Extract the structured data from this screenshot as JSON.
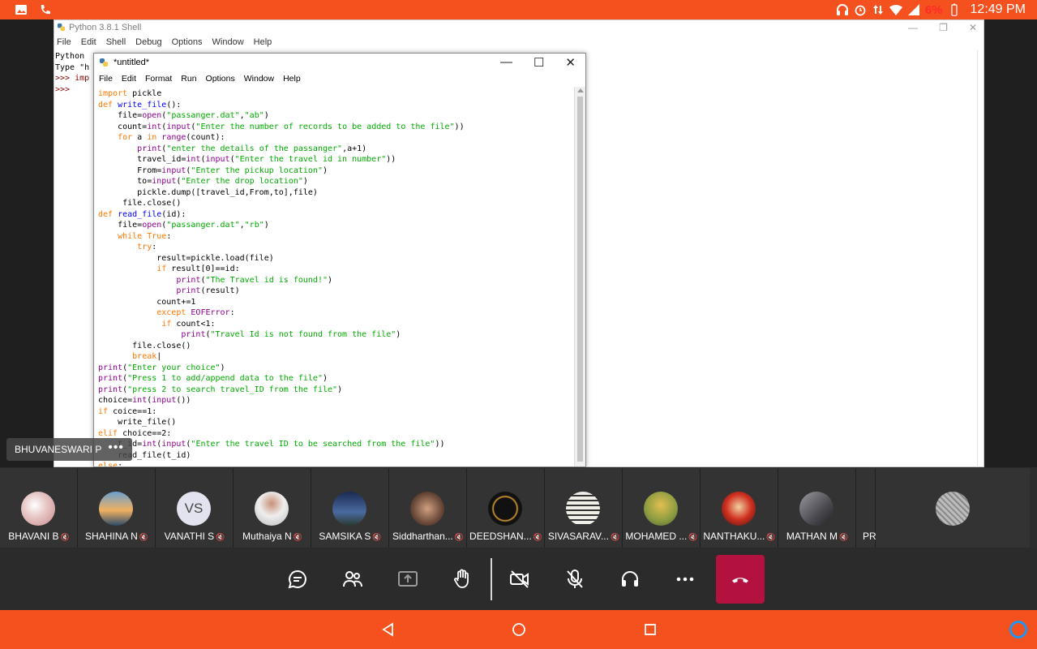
{
  "status_bar": {
    "battery_percent": "6%",
    "time": "12:49 PM",
    "icons": [
      "gallery-icon",
      "phone-icon",
      "headset-icon",
      "alarm-icon",
      "data-arrows-icon",
      "wifi-icon",
      "signal-icon",
      "battery-icon"
    ]
  },
  "shell": {
    "title": "Python 3.8.1 Shell",
    "menu": [
      "File",
      "Edit",
      "Shell",
      "Debug",
      "Options",
      "Window",
      "Help"
    ],
    "lines": [
      "Python",
      "Type \"h",
      ">>> imp",
      ">>>"
    ]
  },
  "editor": {
    "title": "*untitled*",
    "menu": [
      "File",
      "Edit",
      "Format",
      "Run",
      "Options",
      "Window",
      "Help"
    ]
  },
  "speaker": {
    "name": "BHUVANESWARI P",
    "more": "•••"
  },
  "participants": [
    {
      "name": "BHAVANI B",
      "avatar": "photo",
      "color": "#e8c8c8"
    },
    {
      "name": "SHAHINA N",
      "avatar": "photo",
      "color": "#4a7fb0"
    },
    {
      "name": "VANATHI S",
      "avatar": "VS",
      "color": "#e3e3f0"
    },
    {
      "name": "Muthaiya N",
      "avatar": "photo",
      "color": "#d8d0cc"
    },
    {
      "name": "SAMSIKA S",
      "avatar": "photo",
      "color": "#3a5a8a"
    },
    {
      "name": "Siddharthan...",
      "avatar": "photo",
      "color": "#6b4a3a"
    },
    {
      "name": "DEEDSHAN...",
      "avatar": "photo",
      "color": "#111111"
    },
    {
      "name": "SIVASARAV...",
      "avatar": "photo",
      "color": "#c8c8c0"
    },
    {
      "name": "MOHAMED ...",
      "avatar": "photo",
      "color": "#a8a050"
    },
    {
      "name": "NANTHAKU...",
      "avatar": "photo",
      "color": "#a02020"
    },
    {
      "name": "MATHAN M",
      "avatar": "photo",
      "color": "#7a7a80"
    },
    {
      "name": "PR",
      "avatar": "",
      "color": "#333333"
    }
  ],
  "controls": [
    "chat-icon",
    "participants-icon",
    "share-screen-icon",
    "raise-hand-icon",
    "camera-off-icon",
    "mic-off-icon",
    "audio-icon",
    "more-icon",
    "end-call-icon"
  ],
  "nav": [
    "back-icon",
    "home-icon",
    "recents-icon",
    "assistant-icon"
  ]
}
